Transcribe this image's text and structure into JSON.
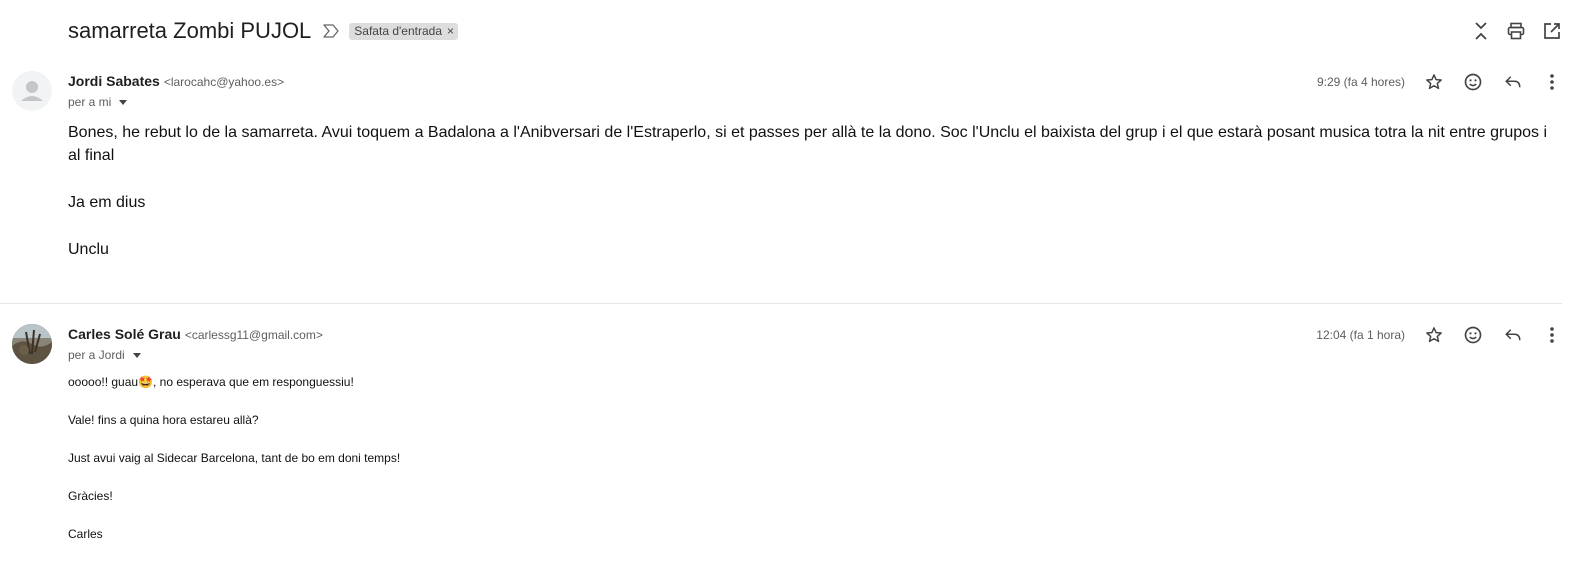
{
  "thread": {
    "subject": "samarreta Zombi PUJOL",
    "label": "Safata d'entrada",
    "label_remove": "×"
  },
  "icons": {
    "important": "importance-marker-icon",
    "collapse": "collapse-all-icon",
    "print": "print-icon",
    "new_window": "open-in-new-window-icon",
    "star": "star-icon",
    "emoji": "emoji-reaction-icon",
    "reply": "reply-icon",
    "more": "more-vert-icon"
  },
  "messages": [
    {
      "sender_name": "Jordi Sabates",
      "sender_email": "<larocahc@yahoo.es>",
      "to": "per a mi",
      "time": "9:29 (fa 4 hores)",
      "paragraphs": [
        "Bones, he rebut lo de la samarreta. Avui toquem a Badalona a l'Anibversari de l'Estraperlo, si et passes per allà te la dono. Soc l'Unclu el baixista del grup i el que estarà posant musica totra la nit entre grupos i al final",
        "Ja em dius",
        "Unclu"
      ]
    },
    {
      "sender_name": "Carles Solé Grau",
      "sender_email": "<carlessg11@gmail.com>",
      "to": "per a Jordi",
      "time": "12:04 (fa 1 hora)",
      "paragraphs": [
        "ooooo!! guau🤩, no esperava que em responguessiu!",
        "Vale! fins a quina hora estareu allà?",
        "Just avui vaig al Sidecar Barcelona, tant de bo em doni temps!",
        "Gràcies!",
        "Carles"
      ]
    }
  ]
}
